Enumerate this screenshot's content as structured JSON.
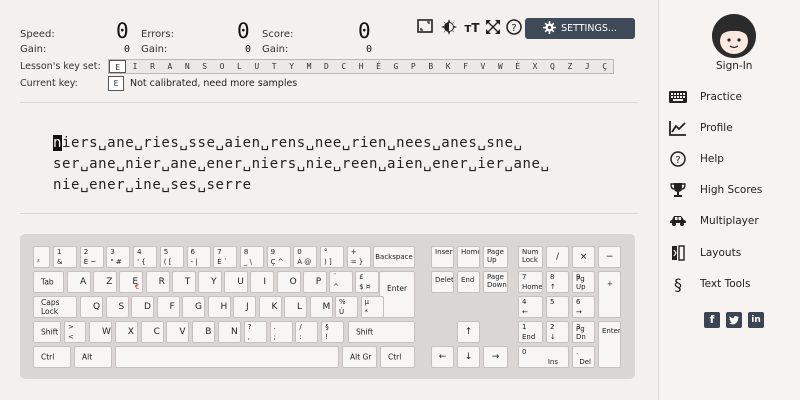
{
  "stats": {
    "speed_label": "Speed:",
    "speed_value": "0",
    "errors_label": "Errors:",
    "errors_value": "0",
    "score_label": "Score:",
    "score_value": "0",
    "gain_label": "Gain:",
    "gain_speed": "0",
    "gain_errors": "0",
    "gain_score": "0"
  },
  "toolbar": {
    "settings_label": "SETTINGS...",
    "icons": [
      "fullscreen-toggle-icon",
      "theme-icon",
      "text-size-icon",
      "expand-icon",
      "help-icon",
      "gear-icon"
    ]
  },
  "lesson": {
    "keyset_label": "Lesson's key set:",
    "keys": [
      "E",
      "I",
      "R",
      "A",
      "N",
      "S",
      "O",
      "L",
      "U",
      "T",
      "Y",
      "M",
      "D",
      "C",
      "H",
      "É",
      "G",
      "P",
      "B",
      "K",
      "F",
      "V",
      "W",
      "È",
      "X",
      "Q",
      "Z",
      "J",
      "Ç"
    ],
    "current_key_label": "Current key:",
    "current_key": "E",
    "calibration_text": "Not calibrated, need more samples",
    "cursor_char": "n",
    "line1_rest": "iers␣ane␣ries␣sse␣aien␣rens␣nee␣rien␣nees␣anes␣sne␣",
    "line2": "ser␣ane␣nier␣ane␣ener␣niers␣nie␣reen␣aien␣ener␣ier␣ane␣",
    "line3": "nie␣ener␣ine␣ses␣serre"
  },
  "keyboard": {
    "backspace": "Backspace",
    "tab": "Tab",
    "enter": "Enter",
    "caps": "Caps Lock",
    "shift_l": "Shift",
    "shift_r": "Shift",
    "ctrl_l": "Ctrl",
    "alt": "Alt",
    "altgr": "Alt Gr",
    "ctrl_r": "Ctrl",
    "insert": "Insert",
    "home": "Home",
    "pageup": "Page\nUp",
    "delete": "Delete",
    "end": "End",
    "pagedown": "Page\nDown",
    "numlock": "Num\nLock",
    "np_div": "/",
    "np_mul": "×",
    "np_sub": "−",
    "np_add": "+",
    "np_enter": "Enter",
    "row0": [
      [
        "²",
        ""
      ],
      [
        "1",
        "&"
      ],
      [
        "2",
        "É ~"
      ],
      [
        "3",
        "\" #"
      ],
      [
        "4",
        "' {"
      ],
      [
        "5",
        "( ["
      ],
      [
        "6",
        "- |"
      ],
      [
        "7",
        "È `"
      ],
      [
        "8",
        "_ \\"
      ],
      [
        "9",
        "Ç ^"
      ],
      [
        "0",
        "À @"
      ],
      [
        "°",
        ") ]"
      ],
      [
        "+",
        "= }"
      ]
    ],
    "row1": [
      "A",
      "Z",
      "E",
      "R",
      "T",
      "Y",
      "U",
      "I",
      "O",
      "P"
    ],
    "row1_extra": [
      [
        "¨",
        "^"
      ],
      [
        "£",
        "$ ¤"
      ]
    ],
    "row2": [
      "Q",
      "S",
      "D",
      "F",
      "G",
      "H",
      "J",
      "K",
      "L",
      "M"
    ],
    "row2_extra": [
      [
        "%",
        "Ù"
      ],
      [
        "µ",
        "*"
      ]
    ],
    "row3": [
      "W",
      "X",
      "C",
      "V",
      "B",
      "N"
    ],
    "row3_extra": [
      [
        "?",
        ","
      ],
      [
        ".",
        ";"
      ],
      [
        "/",
        ":"
      ],
      [
        "§",
        "!"
      ]
    ],
    "row3_lt": [
      ">",
      "<"
    ],
    "row1_e_alt": "€",
    "numpad": {
      "n7": [
        "7",
        "Home"
      ],
      "n8": [
        "8",
        "↑"
      ],
      "n9": [
        "9",
        "Pg Up"
      ],
      "n4": [
        "4",
        "←"
      ],
      "n5": [
        "5",
        ""
      ],
      "n6": [
        "6",
        "→"
      ],
      "n1": [
        "1",
        "End"
      ],
      "n2": [
        "2",
        "↓"
      ],
      "n3": [
        "3",
        "Pg Dn"
      ],
      "n0": [
        "0",
        "Ins"
      ],
      "ndot": [
        ".",
        "Del"
      ]
    },
    "arrows": {
      "up": "↑",
      "left": "←",
      "down": "↓",
      "right": "→"
    }
  },
  "sidebar": {
    "signin": "Sign-In",
    "items": [
      {
        "label": "Practice",
        "icon": "keyboard-icon"
      },
      {
        "label": "Profile",
        "icon": "chart-icon"
      },
      {
        "label": "Help",
        "icon": "help-icon"
      },
      {
        "label": "High Scores",
        "icon": "trophy-icon"
      },
      {
        "label": "Multiplayer",
        "icon": "car-icon"
      },
      {
        "label": "Layouts",
        "icon": "layouts-icon"
      },
      {
        "label": "Text Tools",
        "icon": "section-icon"
      }
    ],
    "social": [
      "facebook-icon",
      "twitter-icon",
      "linkedin-icon"
    ]
  }
}
